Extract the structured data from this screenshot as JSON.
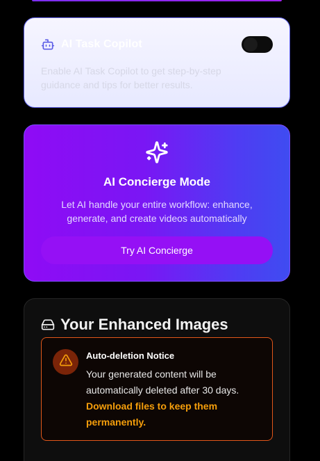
{
  "copilot": {
    "title": "AI Task Copilot",
    "description": "Enable AI Task Copilot to get step-by-step guidance and tips for better results.",
    "toggle_on": false
  },
  "concierge": {
    "title": "AI Concierge Mode",
    "description": "Let AI handle your entire workflow: enhance, generate, and create videos automatically",
    "button_label": "Try AI Concierge"
  },
  "enhanced_images": {
    "title": "Your Enhanced Images",
    "notice": {
      "title": "Auto-deletion Notice",
      "body": "Your generated content will be automatically deleted after 30 days. ",
      "highlight": "Download files to keep them permanently."
    }
  },
  "icons": {
    "copilot": "bot-icon",
    "concierge": "sparkles-icon",
    "images": "hard-drive-icon",
    "notice": "warning-triangle-icon"
  },
  "colors": {
    "accent_purple": "#8f0bf5",
    "accent_indigo": "#6366f1",
    "warning_orange": "#e2571a",
    "warning_text": "#f59e0b"
  }
}
